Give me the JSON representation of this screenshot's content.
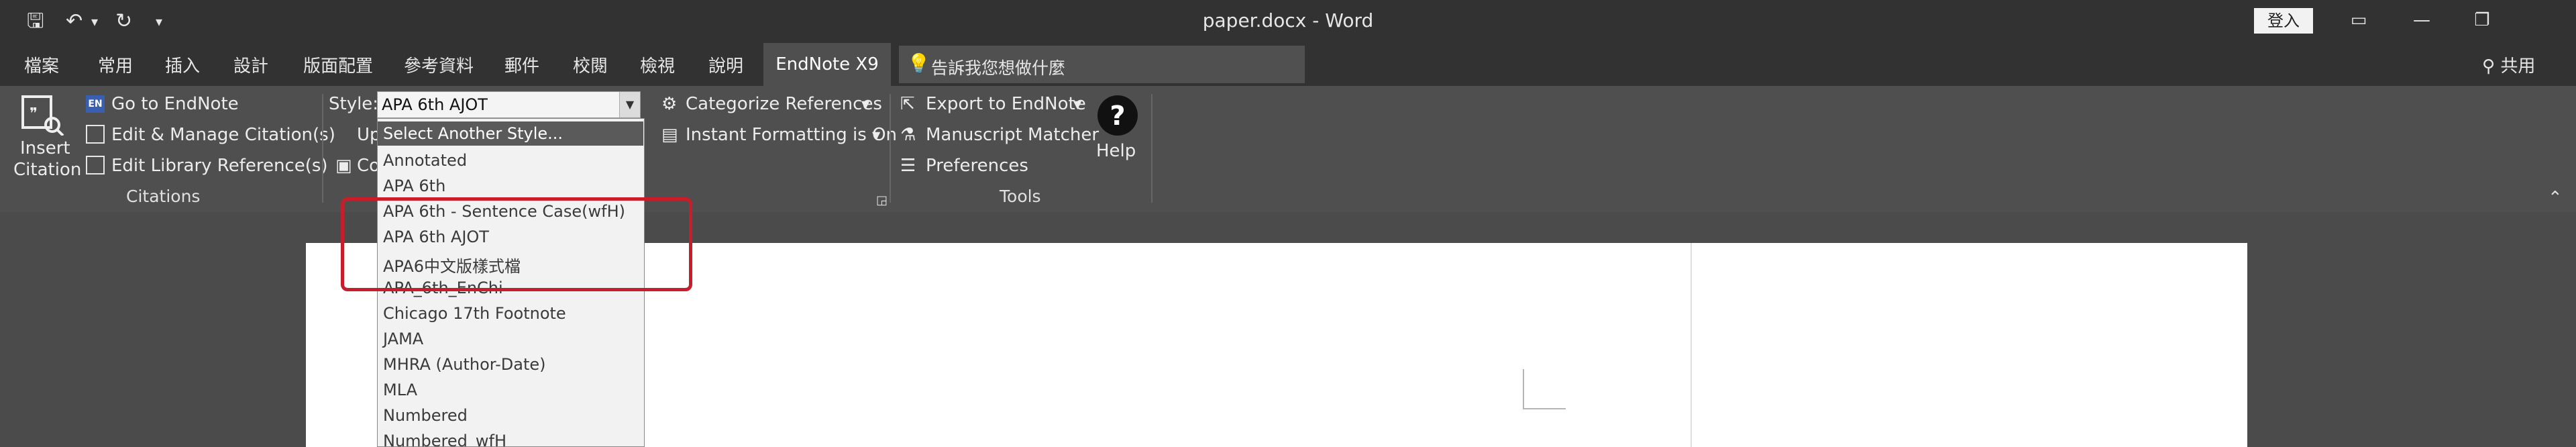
{
  "window": {
    "title": "paper.docx - Word",
    "signin_label": "登入"
  },
  "quick_access": {
    "save": "🖫",
    "undo": "↶",
    "undo_dd": "▾",
    "redo": "↻",
    "customize": "▾"
  },
  "window_controls": {
    "ribbon_display": "▭",
    "minimize": "—",
    "restore": "❐"
  },
  "tabs": [
    "檔案",
    "常用",
    "插入",
    "設計",
    "版面配置",
    "參考資料",
    "郵件",
    "校閱",
    "檢視",
    "說明",
    "EndNote X9"
  ],
  "tell_me": {
    "icon": "lightbulb-icon",
    "placeholder": "告訴我您想做什麼"
  },
  "share_label": "共用",
  "ribbon": {
    "citations": {
      "insert_citation": "Insert\nCitation",
      "insert_line1": "Insert",
      "insert_line2": "Citation",
      "go_to_endnote": "Go to EndNote",
      "edit_manage": "Edit & Manage Citation(s)",
      "edit_library": "Edit Library Reference(s)",
      "group_label": "Citations",
      "up_trunc": "Up",
      "co_trunc": "Co"
    },
    "style": {
      "label": "Style:",
      "value": "APA 6th AJOT",
      "categorize": "Categorize References",
      "instant_formatting": "Instant Formatting is On"
    },
    "tools": {
      "export": "Export to EndNote",
      "manuscript": "Manuscript Matcher",
      "preferences": "Preferences",
      "help": "Help",
      "group_label": "Tools"
    }
  },
  "style_list": [
    "Select Another Style...",
    "Annotated",
    "APA 6th",
    "APA 6th - Sentence Case(wfH)",
    "APA 6th AJOT",
    "APA6中文版樣式檔",
    "APA_6th_EnChi",
    "Chicago 17th Footnote",
    "JAMA",
    "MHRA (Author-Date)",
    "MLA",
    "Numbered",
    "Numbered_wfH"
  ],
  "colors": {
    "titlebar": "#323232",
    "ribbon": "#4f4f4f",
    "highlight_box": "#c81e2b"
  }
}
